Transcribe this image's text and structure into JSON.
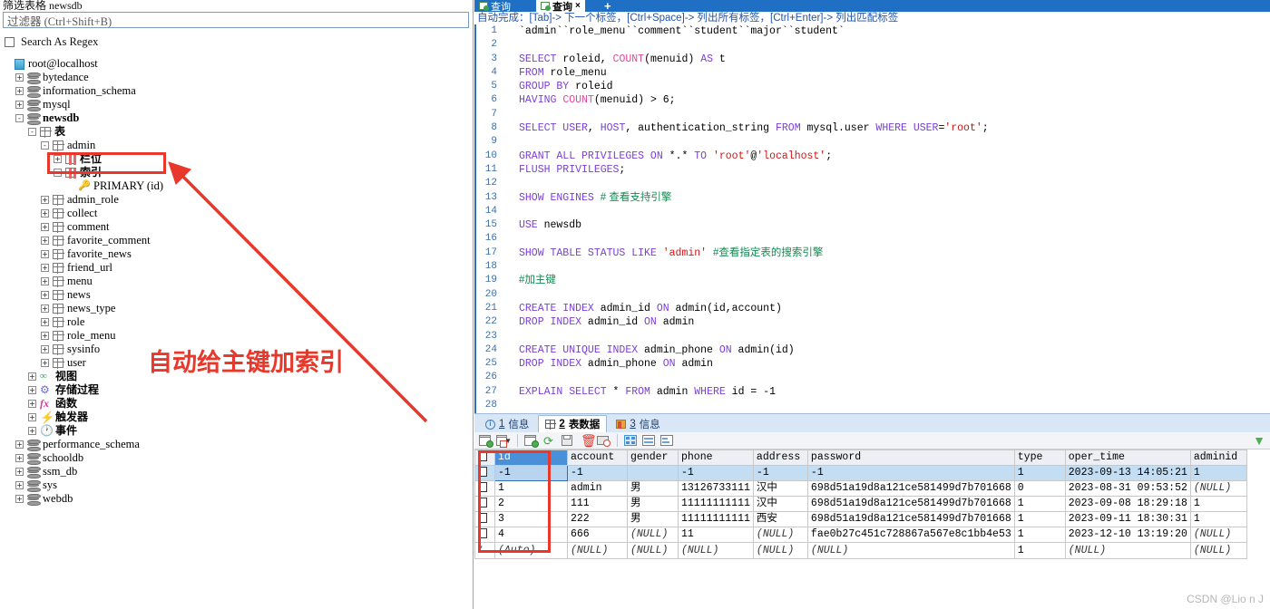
{
  "left_panel": {
    "caption": "筛选表格 newsdb",
    "filter_placeholder": "过滤器 (Ctrl+Shift+B)",
    "regex_label": "Search As Regex",
    "tree": [
      {
        "indent": 0,
        "exp": "",
        "icon": "server-icon",
        "label": "root@localhost",
        "bold": false,
        "cn": false
      },
      {
        "indent": 1,
        "exp": "+",
        "icon": "database-icon",
        "label": "bytedance",
        "bold": false,
        "cn": false
      },
      {
        "indent": 1,
        "exp": "+",
        "icon": "database-icon",
        "label": "information_schema",
        "bold": false,
        "cn": false
      },
      {
        "indent": 1,
        "exp": "+",
        "icon": "database-icon",
        "label": "mysql",
        "bold": false,
        "cn": false
      },
      {
        "indent": 1,
        "exp": "-",
        "icon": "database-icon",
        "label": "newsdb",
        "bold": true,
        "cn": false
      },
      {
        "indent": 2,
        "exp": "-",
        "icon": "table-group-icon",
        "label": "表",
        "bold": false,
        "cn": true
      },
      {
        "indent": 3,
        "exp": "-",
        "icon": "table-icon",
        "label": "admin",
        "bold": false,
        "cn": false
      },
      {
        "indent": 4,
        "exp": "+",
        "icon": "columns-icon",
        "label": "栏位",
        "bold": false,
        "cn": true
      },
      {
        "indent": 4,
        "exp": "-",
        "icon": "columns-icon",
        "label": "索引",
        "bold": false,
        "cn": true
      },
      {
        "indent": 5,
        "exp": "",
        "icon": "key-icon",
        "label": "PRIMARY (id)",
        "bold": false,
        "cn": false
      },
      {
        "indent": 3,
        "exp": "+",
        "icon": "table-icon",
        "label": "admin_role",
        "bold": false,
        "cn": false
      },
      {
        "indent": 3,
        "exp": "+",
        "icon": "table-icon",
        "label": "collect",
        "bold": false,
        "cn": false
      },
      {
        "indent": 3,
        "exp": "+",
        "icon": "table-icon",
        "label": "comment",
        "bold": false,
        "cn": false
      },
      {
        "indent": 3,
        "exp": "+",
        "icon": "table-icon",
        "label": "favorite_comment",
        "bold": false,
        "cn": false
      },
      {
        "indent": 3,
        "exp": "+",
        "icon": "table-icon",
        "label": "favorite_news",
        "bold": false,
        "cn": false
      },
      {
        "indent": 3,
        "exp": "+",
        "icon": "table-icon",
        "label": "friend_url",
        "bold": false,
        "cn": false
      },
      {
        "indent": 3,
        "exp": "+",
        "icon": "table-icon",
        "label": "menu",
        "bold": false,
        "cn": false
      },
      {
        "indent": 3,
        "exp": "+",
        "icon": "table-icon",
        "label": "news",
        "bold": false,
        "cn": false
      },
      {
        "indent": 3,
        "exp": "+",
        "icon": "table-icon",
        "label": "news_type",
        "bold": false,
        "cn": false
      },
      {
        "indent": 3,
        "exp": "+",
        "icon": "table-icon",
        "label": "role",
        "bold": false,
        "cn": false
      },
      {
        "indent": 3,
        "exp": "+",
        "icon": "table-icon",
        "label": "role_menu",
        "bold": false,
        "cn": false
      },
      {
        "indent": 3,
        "exp": "+",
        "icon": "table-icon",
        "label": "sysinfo",
        "bold": false,
        "cn": false
      },
      {
        "indent": 3,
        "exp": "+",
        "icon": "table-icon",
        "label": "user",
        "bold": false,
        "cn": false
      },
      {
        "indent": 2,
        "exp": "+",
        "icon": "view-icon",
        "label": "视图",
        "bold": false,
        "cn": true
      },
      {
        "indent": 2,
        "exp": "+",
        "icon": "procedure-icon",
        "label": "存储过程",
        "bold": false,
        "cn": true
      },
      {
        "indent": 2,
        "exp": "+",
        "icon": "function-icon",
        "label": "函数",
        "bold": false,
        "cn": true
      },
      {
        "indent": 2,
        "exp": "+",
        "icon": "trigger-icon",
        "label": "触发器",
        "bold": false,
        "cn": true
      },
      {
        "indent": 2,
        "exp": "+",
        "icon": "event-icon",
        "label": "事件",
        "bold": false,
        "cn": true
      },
      {
        "indent": 1,
        "exp": "+",
        "icon": "database-icon",
        "label": "performance_schema",
        "bold": false,
        "cn": false
      },
      {
        "indent": 1,
        "exp": "+",
        "icon": "database-icon",
        "label": "schooldb",
        "bold": false,
        "cn": false
      },
      {
        "indent": 1,
        "exp": "+",
        "icon": "database-icon",
        "label": "ssm_db",
        "bold": false,
        "cn": false
      },
      {
        "indent": 1,
        "exp": "+",
        "icon": "database-icon",
        "label": "sys",
        "bold": false,
        "cn": false
      },
      {
        "indent": 1,
        "exp": "+",
        "icon": "database-icon",
        "label": "webdb",
        "bold": false,
        "cn": false
      }
    ],
    "annotation": "自动给主键加索引",
    "annotation_color": "#e8382b"
  },
  "editor": {
    "tabs": [
      {
        "label": "查询",
        "active": false,
        "closable": false
      },
      {
        "label": "查询",
        "active": true,
        "closable": true
      }
    ],
    "new_tab_label": "+",
    "hint": "自动完成：[Tab]-> 下一个标签，[Ctrl+Space]-> 列出所有标签，[Ctrl+Enter]-> 列出匹配标签",
    "lines": [
      {
        "n": "1",
        "html": "<span class='tick'>`admin``role_menu``comment``student``major``student`</span>"
      },
      {
        "n": "2",
        "html": ""
      },
      {
        "n": "3",
        "html": "<span class='kw'>SELECT</span> roleid, <span class='fn'>COUNT</span>(menuid) <span class='kw'>AS</span> t"
      },
      {
        "n": "4",
        "html": "<span class='kw'>FROM</span> role_menu"
      },
      {
        "n": "5",
        "html": "<span class='kw'>GROUP BY</span> roleid"
      },
      {
        "n": "6",
        "html": "<span class='kw'>HAVING</span> <span class='fn'>COUNT</span>(menuid) &gt; 6;"
      },
      {
        "n": "7",
        "html": ""
      },
      {
        "n": "8",
        "html": "<span class='kw'>SELECT USER</span>, <span class='kw'>HOST</span>, authentication_string <span class='kw'>FROM</span> mysql.user <span class='kw'>WHERE USER</span>=<span class='str'>'root'</span>;"
      },
      {
        "n": "9",
        "html": ""
      },
      {
        "n": "10",
        "html": "<span class='kw'>GRANT ALL PRIVILEGES ON</span> *.* <span class='kw'>TO</span> <span class='str'>'root'</span>@<span class='str'>'localhost'</span>;"
      },
      {
        "n": "11",
        "html": "<span class='kw'>FLUSH PRIVILEGES</span>;"
      },
      {
        "n": "12",
        "html": ""
      },
      {
        "n": "13",
        "html": "<span class='kw'>SHOW ENGINES</span> <span class='cmt'># 查看支持引擎</span>"
      },
      {
        "n": "14",
        "html": ""
      },
      {
        "n": "15",
        "html": "<span class='kw'>USE</span> newsdb"
      },
      {
        "n": "16",
        "html": ""
      },
      {
        "n": "17",
        "html": "<span class='kw'>SHOW TABLE STATUS LIKE</span> <span class='str'>'admin'</span> <span class='cmt'>#查看指定表的搜索引擎</span>"
      },
      {
        "n": "18",
        "html": ""
      },
      {
        "n": "19",
        "html": "<span class='cmt'>#加主键</span>"
      },
      {
        "n": "20",
        "html": ""
      },
      {
        "n": "21",
        "html": "<span class='kw'>CREATE INDEX</span> admin_id <span class='kw'>ON</span> admin(id,account)"
      },
      {
        "n": "22",
        "html": "<span class='kw'>DROP INDEX</span> admin_id <span class='kw'>ON</span> admin"
      },
      {
        "n": "23",
        "html": ""
      },
      {
        "n": "24",
        "html": "<span class='kw'>CREATE UNIQUE INDEX</span> admin_phone <span class='kw'>ON</span> admin(id)"
      },
      {
        "n": "25",
        "html": "<span class='kw'>DROP INDEX</span> admin_phone <span class='kw'>ON</span> admin"
      },
      {
        "n": "26",
        "html": ""
      },
      {
        "n": "27",
        "html": "<span class='kw'>EXPLAIN SELECT</span> * <span class='kw'>FROM</span> admin <span class='kw'>WHERE</span> id = -1"
      },
      {
        "n": "28",
        "html": ""
      }
    ]
  },
  "results": {
    "tabs": [
      {
        "num": "1",
        "label": "信息",
        "icon": "info-icon",
        "active": false
      },
      {
        "num": "2",
        "label": "表数据",
        "icon": "grid-icon",
        "active": true
      },
      {
        "num": "3",
        "label": "信息",
        "icon": "message-icon",
        "active": false
      }
    ],
    "toolbar_buttons": [
      "add-record-button",
      "edit-record-dropdown-button",
      "insert-record-button",
      "refresh-button",
      "save-button",
      "delete-record-button",
      "cancel-edit-button",
      "grid-view-button",
      "form-view-button",
      "detail-view-button"
    ],
    "filter_icon": "filter-funnel-icon",
    "columns": [
      "id",
      "account",
      "gender",
      "phone",
      "address",
      "password",
      "type",
      "oper_time",
      "adminid"
    ],
    "selected_column": "id",
    "rows": [
      {
        "selected": true,
        "marker": "checkbox",
        "cells": [
          "-1",
          "-1",
          "",
          "-1",
          "-1",
          "-1",
          "1",
          "2023-09-13 14:05:21",
          "1"
        ]
      },
      {
        "selected": false,
        "marker": "checkbox",
        "cells": [
          "1",
          "admin",
          "男",
          "13126733111",
          "汉中",
          "698d51a19d8a121ce581499d7b701668",
          "0",
          "2023-08-31 09:53:52",
          "(NULL)"
        ]
      },
      {
        "selected": false,
        "marker": "checkbox",
        "cells": [
          "2",
          "111",
          "男",
          "11111111111",
          "汉中",
          "698d51a19d8a121ce581499d7b701668",
          "1",
          "2023-09-08 18:29:18",
          "1"
        ]
      },
      {
        "selected": false,
        "marker": "checkbox",
        "cells": [
          "3",
          "222",
          "男",
          "11111111111",
          "西安",
          "698d51a19d8a121ce581499d7b701668",
          "1",
          "2023-09-11 18:30:31",
          "1"
        ]
      },
      {
        "selected": false,
        "marker": "checkbox",
        "cells": [
          "4",
          "666",
          "(NULL)",
          "11",
          "(NULL)",
          "fae0b27c451c728867a567e8c1bb4e53",
          "1",
          "2023-12-10 13:19:20",
          "(NULL)"
        ]
      },
      {
        "selected": false,
        "marker": "star",
        "cells": [
          "(Auto)",
          "(NULL)",
          "(NULL)",
          "(NULL)",
          "(NULL)",
          "(NULL)",
          "1",
          "(NULL)",
          "(NULL)"
        ]
      }
    ]
  },
  "watermark": "CSDN @Lio n  J"
}
